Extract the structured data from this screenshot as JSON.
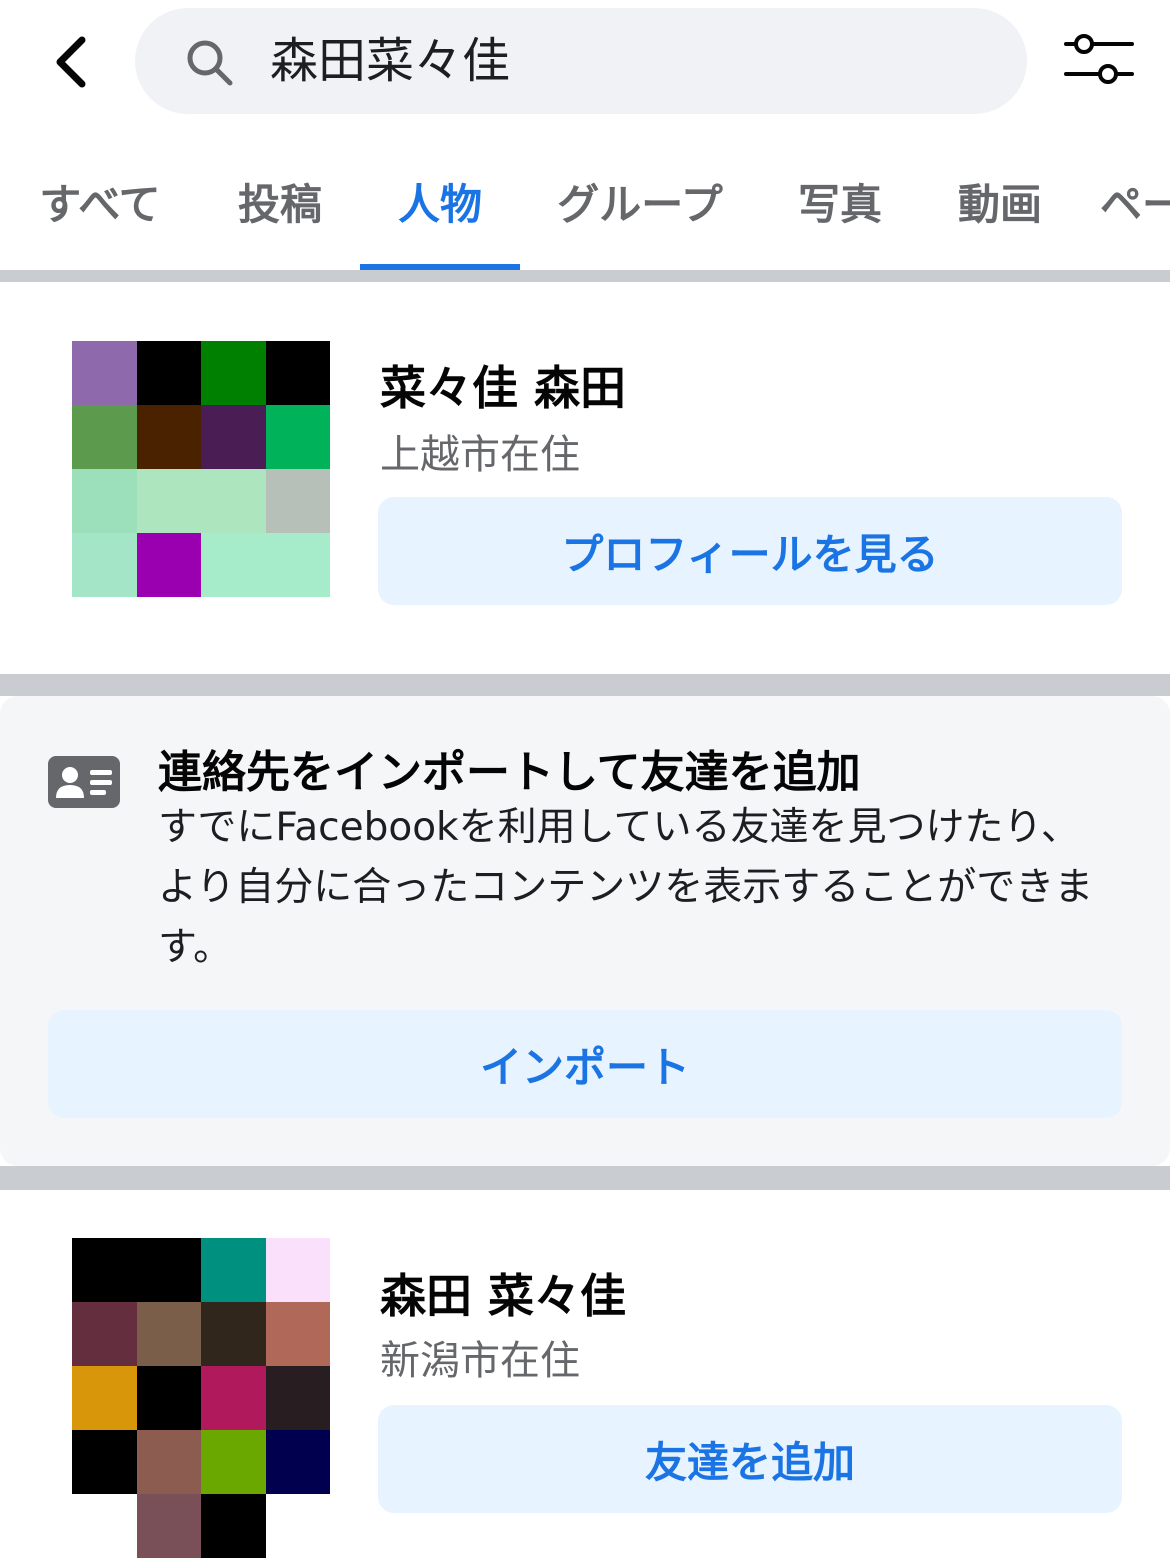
{
  "header": {
    "search_value": "森田菜々佳",
    "back_icon": "chevron-left-icon",
    "search_icon": "search-icon",
    "filter_icon": "sliders-icon"
  },
  "tabs": [
    {
      "label": "すべて",
      "active": false
    },
    {
      "label": "投稿",
      "active": false
    },
    {
      "label": "人物",
      "active": true
    },
    {
      "label": "グループ",
      "active": false
    },
    {
      "label": "写真",
      "active": false
    },
    {
      "label": "動画",
      "active": false
    },
    {
      "label": "ペー",
      "active": false
    }
  ],
  "results": [
    {
      "name": "菜々佳 森田",
      "location": "上越市在住",
      "action_label": "プロフィールを見る",
      "avatar_colors": [
        "#8e6aad",
        "#000000",
        "#008000",
        "#000000",
        "#5c9a4d",
        "#4a2200",
        "#4a1e55",
        "#00b35a",
        "#9cdfbb",
        "#ade5be",
        "#ade5be",
        "#b6bfb8",
        "#a4e5c8",
        "#9a00b0",
        "#a6ebca",
        "#a6ebca"
      ]
    },
    {
      "name": "森田 菜々佳",
      "location": "新潟市在住",
      "action_label": "友達を追加",
      "avatar_colors": [
        "#000000",
        "#000000",
        "#009080",
        "#fbe0fb",
        "#642e3e",
        "#7a5e4a",
        "#30261c",
        "#b06858",
        "#d8960a",
        "#000000",
        "#b01a5c",
        "#281e22",
        "#000000",
        "#8c5c50",
        "#6aa800",
        "#00004e",
        "#ffffff",
        "#7a5058",
        "#000000",
        "#ffffff"
      ]
    }
  ],
  "import_card": {
    "icon": "contact-card-icon",
    "title": "連絡先をインポートして友達を追加",
    "body": "すでにFacebookを利用している友達を見つけたり、より自分に合ったコンテンツを表示することができます。",
    "button_label": "インポート"
  },
  "colors": {
    "accent": "#1b74e4",
    "button_bg": "#e7f3ff",
    "secondary_text": "#65676b",
    "divider": "#c9ccd1"
  }
}
